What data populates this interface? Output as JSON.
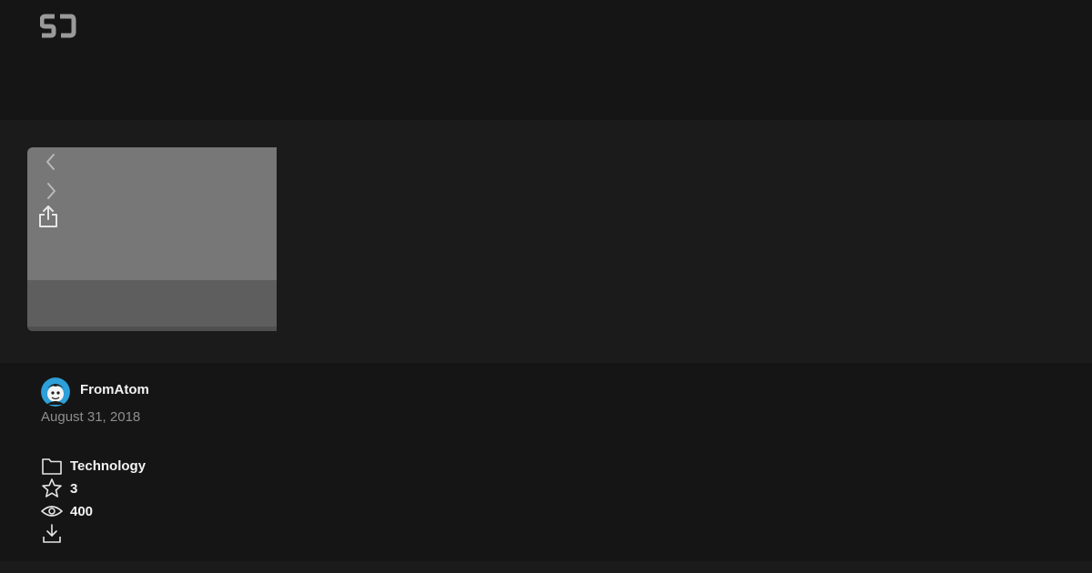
{
  "brand": {
    "logo_text": "SJ",
    "logo_color": "#9a9a9a"
  },
  "viewer": {
    "background": "#777777",
    "footer_background": "#5e5e5e",
    "prev_icon": "chevron-left-icon",
    "next_icon": "chevron-right-icon",
    "share_icon": "share-icon"
  },
  "author": {
    "name": "FromAtom",
    "avatar_icon": "avatar-icon",
    "date": "August 31, 2018"
  },
  "meta": {
    "category": "Technology",
    "category_icon": "folder-icon",
    "stars": "3",
    "stars_icon": "star-icon",
    "views": "400",
    "views_icon": "eye-icon",
    "download_icon": "download-icon"
  },
  "colors": {
    "page_background": "#151515",
    "stage_background": "#1b1b1b",
    "text_primary": "#f2f2f2",
    "text_secondary": "#8e8e8e"
  }
}
